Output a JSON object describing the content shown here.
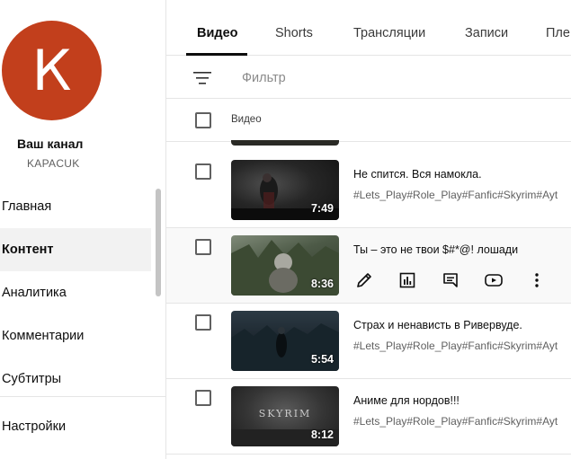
{
  "sidebar": {
    "avatar_letter": "К",
    "channel_title": "Ваш канал",
    "channel_handle": "KAPACUK",
    "items": [
      {
        "label": "Главная"
      },
      {
        "label": "Контент"
      },
      {
        "label": "Аналитика"
      },
      {
        "label": "Комментарии"
      },
      {
        "label": "Субтитры"
      },
      {
        "label": "Настройки"
      }
    ]
  },
  "tabs": [
    {
      "label": "Видео"
    },
    {
      "label": "Shorts"
    },
    {
      "label": "Трансляции"
    },
    {
      "label": "Записи"
    },
    {
      "label": "Пле"
    }
  ],
  "filter": {
    "placeholder": "Фильтр"
  },
  "table": {
    "column_video": "Видео"
  },
  "videos": [
    {
      "title": "Не спится. Вся намокла.",
      "description": "#Lets_Play#Role_Play#Fanfic#Skyrim#Ayt",
      "duration": "7:49"
    },
    {
      "title": "Ты – это не твои $#*@! лошади",
      "description": "",
      "duration": "8:36"
    },
    {
      "title": "Страх и ненависть в Ривервуде.",
      "description": "#Lets_Play#Role_Play#Fanfic#Skyrim#Ayt",
      "duration": "5:54"
    },
    {
      "title": "Аниме для нордов!!!",
      "description": "#Lets_Play#Role_Play#Fanfic#Skyrim#Ayt",
      "duration": "8:12",
      "thumb_text": "SKYRIM"
    }
  ],
  "colors": {
    "avatar": "#c23f1c",
    "divider": "#e5e5e5",
    "active_bg": "#f2f2f2"
  }
}
